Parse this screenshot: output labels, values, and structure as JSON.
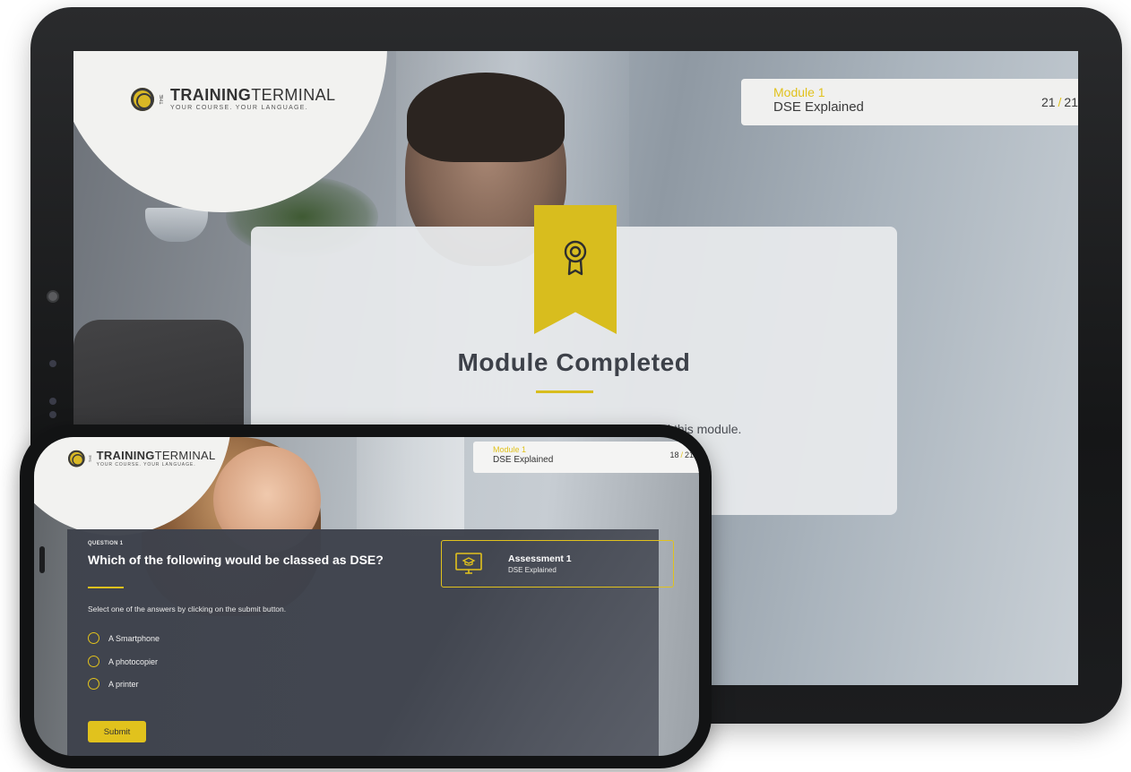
{
  "tablet": {
    "logo": {
      "the": "THE",
      "brand_bold": "TRAINING",
      "brand_light": "TERMINAL",
      "tagline": "YOUR COURSE. YOUR LANGUAGE."
    },
    "module_card": {
      "label": "Module 1",
      "title": "DSE Explained",
      "page_current": "21",
      "page_separator": "/",
      "page_total": "21"
    },
    "completion": {
      "icon": "award-ribbon-icon",
      "title": "Module Completed",
      "message_line1": "Congratulations! You've successfully completed this module.",
      "message_line2": "...odule."
    }
  },
  "phone": {
    "logo": {
      "the": "THE",
      "brand_bold": "TRAINING",
      "brand_light": "TERMINAL",
      "tagline": "YOUR COURSE. YOUR LANGUAGE."
    },
    "module_card": {
      "label": "Module 1",
      "title": "DSE Explained",
      "page_current": "18",
      "page_separator": "/",
      "page_total": "21"
    },
    "question": {
      "label": "QUESTION 1",
      "text": "Which of the following would be classed as DSE?",
      "instruction": "Select one of the answers by clicking on the submit button.",
      "options": [
        "A Smartphone",
        "A photocopier",
        "A printer"
      ],
      "submit_label": "Submit"
    },
    "assessment": {
      "icon": "monitor-graduation-icon",
      "title": "Assessment 1",
      "subtitle": "DSE Explained"
    }
  },
  "colors": {
    "accent": "#e1c21d",
    "panel": "#3e424c",
    "text_dark": "#3d4149"
  }
}
